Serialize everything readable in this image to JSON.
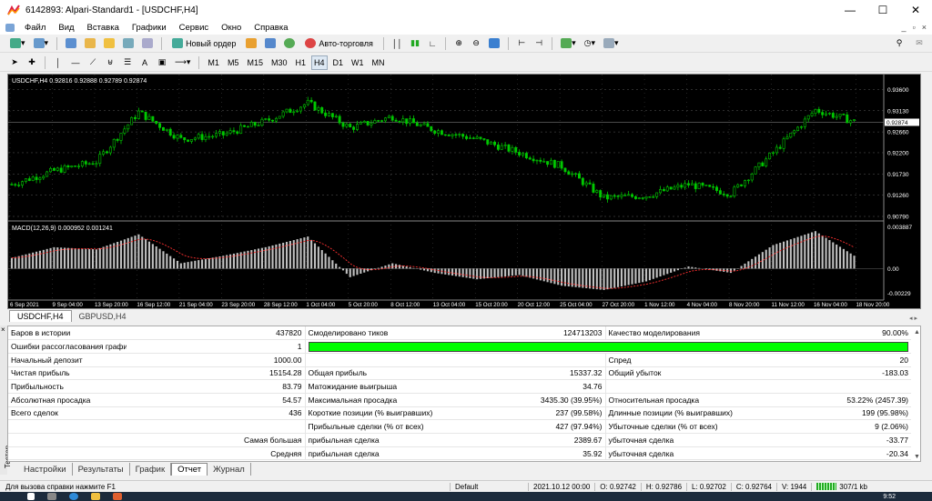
{
  "window": {
    "title": "6142893: Alpari-Standard1 - [USDCHF,H4]"
  },
  "menu": [
    "Файл",
    "Вид",
    "Вставка",
    "Графики",
    "Сервис",
    "Окно",
    "Справка"
  ],
  "toolbar1": {
    "new_order": "Новый ордер",
    "auto_trading": "Авто-торговля"
  },
  "timeframes": [
    "M1",
    "M5",
    "M15",
    "M30",
    "H1",
    "H4",
    "D1",
    "W1",
    "MN"
  ],
  "active_timeframe": "H4",
  "chart": {
    "header": "USDCHF,H4  0.92816 0.92888 0.92789 0.92874",
    "macd_header": "MACD(12,26,9) 0.000952 0.001241",
    "current_price": "0.92874",
    "price_levels": [
      "0.93600",
      "0.93130",
      "0.92660",
      "0.92200",
      "0.91730",
      "0.91260",
      "0.90790"
    ],
    "macd_levels": [
      "0.003887",
      "0.00",
      "-0.00229"
    ],
    "time_labels": [
      "6 Sep 2021",
      "9 Sep 04:00",
      "13 Sep 20:00",
      "16 Sep 12:00",
      "21 Sep 04:00",
      "23 Sep 20:00",
      "28 Sep 12:00",
      "1 Oct 04:00",
      "5 Oct 20:00",
      "8 Oct 12:00",
      "13 Oct 04:00",
      "15 Oct 20:00",
      "20 Oct 12:00",
      "25 Oct 04:00",
      "27 Oct 20:00",
      "1 Nov 12:00",
      "4 Nov 04:00",
      "8 Nov 20:00",
      "11 Nov 12:00",
      "16 Nov 04:00",
      "18 Nov 20:00"
    ],
    "colors": {
      "bull": "#00c800",
      "bear": "#00c800",
      "macd_hist": "#c0c0c0",
      "signal": "#ff3030",
      "grid": "#5a5a5a"
    }
  },
  "chart_data": {
    "type": "line",
    "title": "USDCHF,H4",
    "ylim": [
      0.9075,
      0.9385
    ],
    "x": [
      "6 Sep 2021",
      "9 Sep 04:00",
      "13 Sep 20:00",
      "16 Sep 12:00",
      "21 Sep 04:00",
      "23 Sep 20:00",
      "28 Sep 12:00",
      "1 Oct 04:00",
      "5 Oct 20:00",
      "8 Oct 12:00",
      "13 Oct 04:00",
      "15 Oct 20:00",
      "20 Oct 12:00",
      "25 Oct 04:00",
      "27 Oct 20:00",
      "1 Nov 12:00",
      "4 Nov 04:00",
      "8 Nov 20:00",
      "11 Nov 12:00",
      "16 Nov 04:00",
      "18 Nov 20:00"
    ],
    "series": [
      {
        "name": "USDCHF",
        "values": [
          0.915,
          0.918,
          0.92,
          0.931,
          0.925,
          0.926,
          0.929,
          0.933,
          0.9275,
          0.93,
          0.927,
          0.925,
          0.922,
          0.919,
          0.912,
          0.9125,
          0.915,
          0.913,
          0.922,
          0.9315,
          0.9287
        ]
      },
      {
        "name": "MACD",
        "values": [
          0.001,
          0.002,
          0.0018,
          0.0032,
          0.0005,
          0.0012,
          0.002,
          0.003,
          -0.0008,
          0.0005,
          -0.0004,
          -0.001,
          -0.0006,
          -0.0016,
          -0.002,
          -0.0012,
          0.0002,
          -0.0004,
          0.0022,
          0.0035,
          0.001
        ]
      }
    ]
  },
  "symbol_tabs": [
    "USDCHF,H4",
    "GBPUSD,H4"
  ],
  "active_symbol_tab": "USDCHF,H4",
  "report": {
    "rows": [
      [
        "Баров в истории",
        "437820",
        "Смоделировано тиков",
        "124713203",
        "Качество моделирования",
        "90.00%"
      ],
      [
        "Ошибки рассогласования графиков",
        "1",
        "",
        "",
        "",
        ""
      ],
      [
        "Начальный депозит",
        "1000.00",
        "",
        "",
        "Спред",
        "20"
      ],
      [
        "Чистая прибыль",
        "15154.28",
        "Общая прибыль",
        "15337.32",
        "Общий убыток",
        "-183.03"
      ],
      [
        "Прибыльность",
        "83.79",
        "Матожидание выигрыша",
        "34.76",
        "",
        ""
      ],
      [
        "Абсолютная просадка",
        "54.57",
        "Максимальная просадка",
        "3435.30 (39.95%)",
        "Относительная просадка",
        "53.22% (2457.39)"
      ],
      [
        "Всего сделок",
        "436",
        "Короткие позиции (% выигравших)",
        "237 (99.58%)",
        "Длинные позиции (% выигравших)",
        "199 (95.98%)"
      ],
      [
        "",
        "",
        "Прибыльные сделки (% от всех)",
        "427 (97.94%)",
        "Убыточные сделки (% от всех)",
        "9 (2.06%)"
      ],
      [
        "",
        "Самая большая",
        "прибыльная сделка",
        "2389.67",
        "убыточная сделка",
        "-33.77"
      ],
      [
        "",
        "Средняя",
        "прибыльная сделка",
        "35.92",
        "убыточная сделка",
        "-20.34"
      ]
    ],
    "quality_bar_color": "#00ff00"
  },
  "side_label": "Тестер",
  "bottom_tabs": [
    "Настройки",
    "Результаты",
    "График",
    "Отчет",
    "Журнал"
  ],
  "active_bottom_tab": "Отчет",
  "status": {
    "help": "Для вызова справки нажмите F1",
    "profile": "Default",
    "datetime": "2021.10.12 00:00",
    "open": "O: 0.92742",
    "high": "H: 0.92786",
    "low": "L: 0.92702",
    "close": "C: 0.92764",
    "volume": "V: 1944",
    "traffic": "307/1 kb"
  },
  "taskbar": {
    "time": "9:52"
  }
}
